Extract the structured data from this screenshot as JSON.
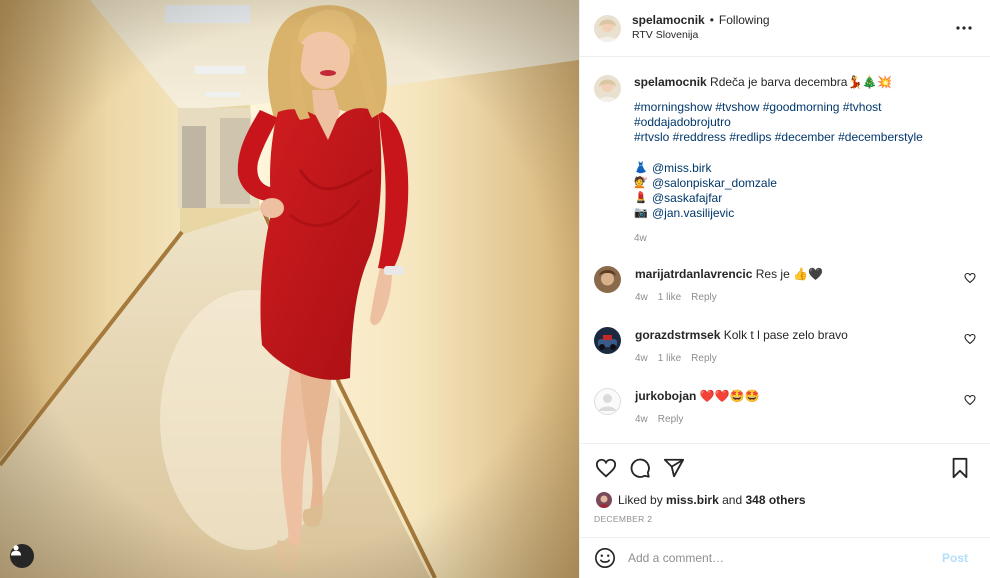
{
  "header": {
    "username": "spelamocnik",
    "separator": "•",
    "follow_label": "Following",
    "location": "RTV Slovenija"
  },
  "caption": {
    "username": "spelamocnik",
    "text": "Rdeča je barva decembra",
    "hashtags_line1": "#morningshow #tvshow #goodmorning #tvhost #oddajadobrojutro",
    "hashtags_line2": "#rtvslo #reddress #redlips #december #decemberstyle",
    "credits": [
      {
        "icon": "dress-emoji",
        "glyph": "👗",
        "mention": "@miss.birk"
      },
      {
        "icon": "hairdresser-emoji",
        "glyph": "💇",
        "mention": "@salonpiskar_domzale"
      },
      {
        "icon": "lipstick-emoji",
        "glyph": "💄",
        "mention": "@saskafajfar"
      },
      {
        "icon": "camera-emoji",
        "glyph": "📷",
        "mention": "@jan.vasilijevic"
      }
    ],
    "age": "4w"
  },
  "comments": [
    {
      "username": "marijatrdanlavrencic",
      "text": "Res je 👍🖤",
      "age": "4w",
      "likes": "1 like",
      "reply": "Reply"
    },
    {
      "username": "gorazdstrmsek",
      "text": "Kolk t l pase zelo bravo",
      "age": "4w",
      "likes": "1 like",
      "reply": "Reply"
    },
    {
      "username": "jurkobojan",
      "text": "❤️❤️🤩🤩",
      "age": "4w",
      "likes": "",
      "reply": "Reply"
    }
  ],
  "likes": {
    "prefix": "Liked by",
    "user": "miss.birk",
    "and": "and",
    "others": "348 others"
  },
  "date": "DECEMBER 2",
  "add_comment": {
    "placeholder": "Add a comment…",
    "post_label": "Post"
  },
  "colors": {
    "link": "#00376b",
    "muted": "#8e8e8e",
    "post_disabled": "#b2dffc",
    "dress": "#c8151b"
  }
}
